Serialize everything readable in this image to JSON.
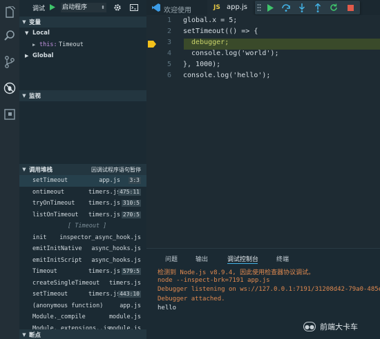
{
  "activity_icons": [
    "files-icon",
    "search-icon",
    "source-control-icon",
    "debug-icon",
    "extensions-icon"
  ],
  "debug_bar": {
    "label": "调试",
    "config": "启动程序"
  },
  "variables": {
    "title": "变量",
    "local": "Local",
    "this_key": "this:",
    "this_val": "Timeout",
    "global": "Global"
  },
  "watch": {
    "title": "监视"
  },
  "callstack": {
    "title": "调用堆栈",
    "status": "因调试程序语句暂停",
    "frames": [
      {
        "fn": "setTimeout",
        "file": "app.js",
        "line": "3:3"
      },
      {
        "fn": "ontimeout",
        "file": "timers.js",
        "line": "475:11"
      },
      {
        "fn": "tryOnTimeout",
        "file": "timers.js",
        "line": "310:5"
      },
      {
        "fn": "listOnTimeout",
        "file": "timers.js",
        "line": "270:5"
      },
      {
        "fn": "[ Timeout ]",
        "file": "",
        "line": ""
      },
      {
        "fn": "init",
        "file": "inspector_async_hook.js",
        "line": ""
      },
      {
        "fn": "emitInitNative",
        "file": "async_hooks.js",
        "line": ""
      },
      {
        "fn": "emitInitScript",
        "file": "async_hooks.js",
        "line": ""
      },
      {
        "fn": "Timeout",
        "file": "timers.js",
        "line": "579:5"
      },
      {
        "fn": "createSingleTimeout",
        "file": "timers.js",
        "line": ""
      },
      {
        "fn": "setTimeout",
        "file": "timers.js",
        "line": "443:10"
      },
      {
        "fn": "(anonymous function)",
        "file": "app.js",
        "line": ""
      },
      {
        "fn": "Module._compile",
        "file": "module.js",
        "line": ""
      },
      {
        "fn": "Module._extensions..js",
        "file": "module.js",
        "line": ""
      }
    ]
  },
  "breakpoints": {
    "title": "断点"
  },
  "tabs": [
    {
      "label": "欢迎使用",
      "badge": ""
    },
    {
      "label": "app.js",
      "badge": "JS"
    }
  ],
  "code_lines": [
    {
      "n": "1",
      "text": "global.x = 5;"
    },
    {
      "n": "2",
      "text": "setTimeout(() => {"
    },
    {
      "n": "3",
      "text": "  debugger;"
    },
    {
      "n": "4",
      "text": "  console.log('world');"
    },
    {
      "n": "5",
      "text": "}, 1000);"
    },
    {
      "n": "6",
      "text": "console.log('hello');"
    }
  ],
  "panel_tabs": [
    "问题",
    "输出",
    "调试控制台",
    "终端"
  ],
  "console_lines": [
    {
      "text": "检测到 Node.js v8.9.4, 因此使用检查器协议调试。",
      "color": "#e0894f"
    },
    {
      "text": "node --inspect-brk=7191 app.js",
      "color": "#e0894f"
    },
    {
      "text": "Debugger listening on ws://127.0.0.1:7191/31208d42-79a0-485e",
      "color": "#e0894f"
    },
    {
      "text": "Debugger attached.",
      "color": "#e0894f"
    },
    {
      "text": "hello",
      "color": "#d7dfe5"
    }
  ],
  "watermark": "前端大卡车",
  "colors": {
    "accent": "#43b3e6",
    "highlight_line": "#3a4a2a",
    "breakpoint": "#f4c11b"
  }
}
